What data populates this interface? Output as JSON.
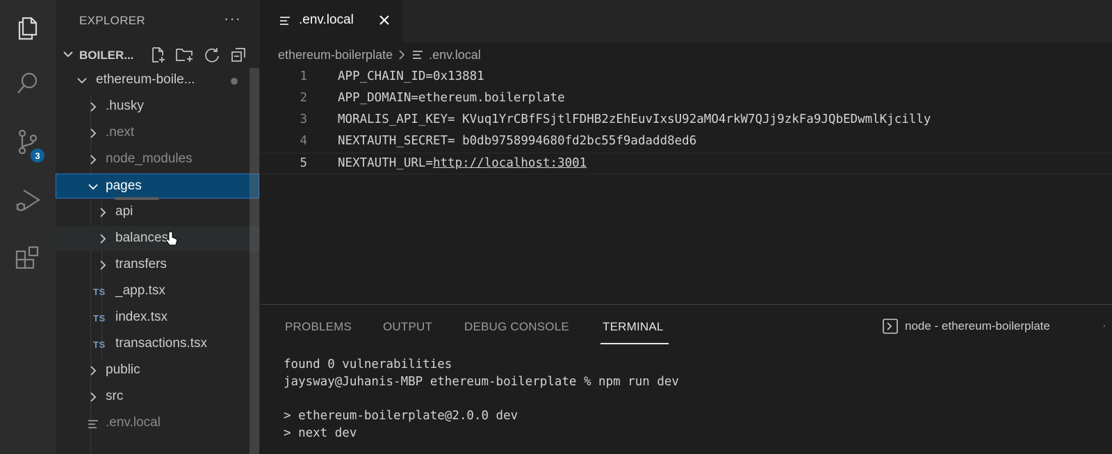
{
  "activity_bar": {
    "items": [
      {
        "name": "explorer",
        "icon": "files-icon"
      },
      {
        "name": "search",
        "icon": "search-icon"
      },
      {
        "name": "source-control",
        "icon": "source-control-icon",
        "badge": "3"
      },
      {
        "name": "run-and-debug",
        "icon": "run-debug-icon"
      },
      {
        "name": "extensions",
        "icon": "extensions-icon"
      }
    ]
  },
  "sidebar": {
    "header": "EXPLORER",
    "more": "···",
    "section_title": "BOILER...",
    "tree": [
      {
        "label": "ethereum-boile...",
        "type": "folder",
        "expanded": true
      },
      {
        "label": ".husky",
        "type": "folder"
      },
      {
        "label": ".next",
        "type": "folder"
      },
      {
        "label": "node_modules",
        "type": "folder"
      },
      {
        "label": "pages",
        "type": "folder",
        "expanded": true
      },
      {
        "label": "api",
        "type": "folder"
      },
      {
        "label": "balances",
        "type": "folder"
      },
      {
        "label": "transfers",
        "type": "folder"
      },
      {
        "label": "_app.tsx",
        "type": "file",
        "badge": "TS"
      },
      {
        "label": "index.tsx",
        "type": "file",
        "badge": "TS"
      },
      {
        "label": "transactions.tsx",
        "type": "file",
        "badge": "TS"
      },
      {
        "label": "public",
        "type": "folder"
      },
      {
        "label": "src",
        "type": "folder"
      },
      {
        "label": ".env.local",
        "type": "file"
      }
    ]
  },
  "editor": {
    "tab_label": ".env.local",
    "breadcrumb": [
      "ethereum-boilerplate",
      ".env.local"
    ],
    "lines": [
      {
        "n": "1",
        "text": "APP_CHAIN_ID=0x13881"
      },
      {
        "n": "2",
        "text": "APP_DOMAIN=ethereum.boilerplate"
      },
      {
        "n": "3",
        "text": "MORALIS_API_KEY= KVuq1YrCBfFSjtlFDHB2zEhEuvIxsU92aMO4rkW7QJj9zkFa9JQbEDwmlKjcilly"
      },
      {
        "n": "4",
        "text": "NEXTAUTH_SECRET= b0db9758994680fd2bc55f9adadd8ed6"
      },
      {
        "n": "5",
        "text_prefix": "NEXTAUTH_URL=",
        "url": "http://localhost:3001"
      }
    ]
  },
  "panel": {
    "tabs": [
      "PROBLEMS",
      "OUTPUT",
      "DEBUG CONSOLE",
      "TERMINAL"
    ],
    "active_tab": "TERMINAL",
    "terminal_selector": "node - ethereum-boilerplate",
    "terminal_lines": [
      "found 0 vulnerabilities",
      "jaysway@Juhanis-MBP ethereum-boilerplate % npm run dev",
      "",
      "> ethereum-boilerplate@2.0.0 dev",
      "> next dev"
    ]
  },
  "colors": {
    "accent": "#0e639c",
    "selection": "#094771",
    "background": "#1e1e1e",
    "sidebar": "#252526"
  }
}
